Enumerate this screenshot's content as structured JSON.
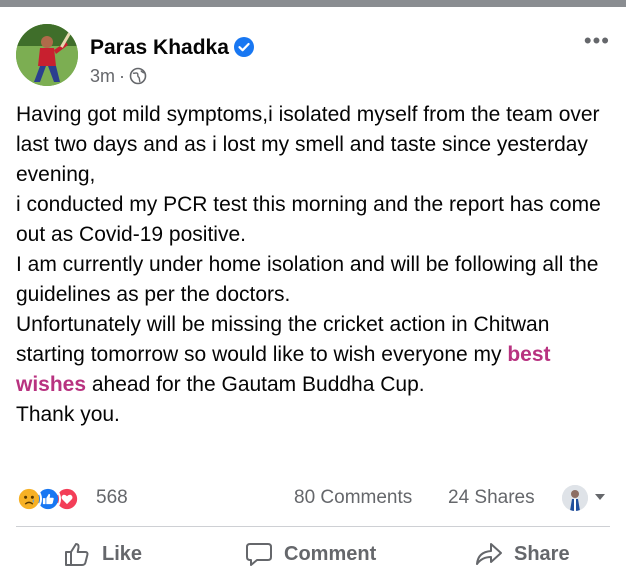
{
  "post": {
    "author": "Paras Khadka",
    "time": "3m",
    "separator": "·",
    "more_label": "•••",
    "body": [
      [
        "Having got mild symptoms,i isolated myself from the team over last two days and as i lost my smell and taste since yesterday evening,"
      ],
      [
        "i conducted my PCR test this morning and the report has come out as Covid-19 positive."
      ],
      [
        "I am currently under home isolation and will be following all the guidelines as per the doctors."
      ],
      [
        "Unfortunately will be missing the cricket action in Chitwan starting tomorrow so would like to wish everyone my ",
        "best wishes",
        " ahead for the Gautam Buddha Cup."
      ],
      [
        "Thank you."
      ]
    ]
  },
  "stats": {
    "reactions": [
      "sad",
      "like",
      "love"
    ],
    "reactions_count": "568",
    "comments": "80 Comments",
    "shares": "24 Shares"
  },
  "actions": {
    "like": "Like",
    "comment": "Comment",
    "share": "Share"
  },
  "colors": {
    "highlight": "#b83280",
    "like_blue": "#1877f2",
    "love_red": "#f33e58",
    "sad_yellow": "#f7b125",
    "secondary_text": "#65676b"
  }
}
